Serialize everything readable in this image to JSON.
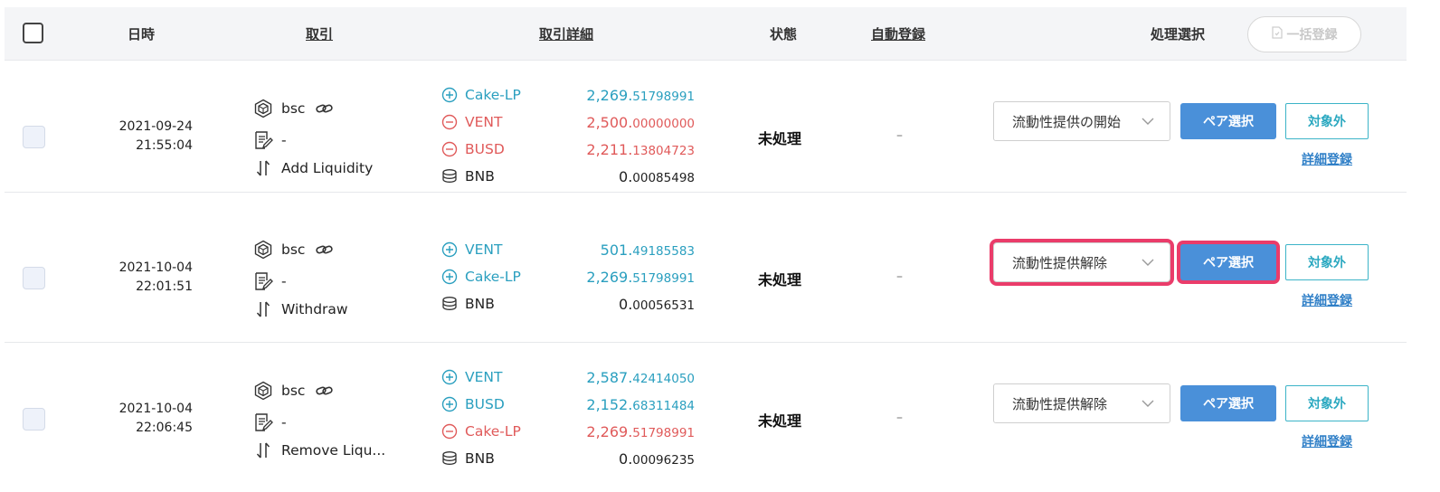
{
  "header": {
    "datetime": "日時",
    "transaction": "取引",
    "transaction_detail": "取引詳細",
    "status": "状態",
    "auto_register": "自動登録",
    "process_select": "処理選択",
    "bulk_register": "一括登録"
  },
  "rows": [
    {
      "date": "2021-09-24",
      "time": "21:55:04",
      "chain": "bsc",
      "memo": "-",
      "action": "Add Liquidity",
      "details": [
        {
          "dir": "in",
          "token": "Cake-LP",
          "int": "2,269.",
          "dec": "51798991"
        },
        {
          "dir": "out",
          "token": "VENT",
          "int": "2,500.",
          "dec": "00000000"
        },
        {
          "dir": "out",
          "token": "BUSD",
          "int": "2,211.",
          "dec": "13804723"
        },
        {
          "dir": "fee",
          "token": "BNB",
          "int": "0.",
          "dec": "00085498"
        }
      ],
      "status": "未処理",
      "auto": "–",
      "select_value": "流動性提供の開始",
      "pair_button": "ペア選択",
      "exclude_button": "対象外",
      "detail_link": "詳細登録"
    },
    {
      "date": "2021-10-04",
      "time": "22:01:51",
      "chain": "bsc",
      "memo": "-",
      "action": "Withdraw",
      "details": [
        {
          "dir": "in",
          "token": "VENT",
          "int": "501.",
          "dec": "49185583"
        },
        {
          "dir": "in",
          "token": "Cake-LP",
          "int": "2,269.",
          "dec": "51798991"
        },
        {
          "dir": "fee",
          "token": "BNB",
          "int": "0.",
          "dec": "00056531"
        }
      ],
      "status": "未処理",
      "auto": "–",
      "select_value": "流動性提供解除",
      "pair_button": "ペア選択",
      "exclude_button": "対象外",
      "detail_link": "詳細登録"
    },
    {
      "date": "2021-10-04",
      "time": "22:06:45",
      "chain": "bsc",
      "memo": "-",
      "action": "Remove Liqu...",
      "details": [
        {
          "dir": "in",
          "token": "VENT",
          "int": "2,587.",
          "dec": "42414050"
        },
        {
          "dir": "in",
          "token": "BUSD",
          "int": "2,152.",
          "dec": "68311484"
        },
        {
          "dir": "out",
          "token": "Cake-LP",
          "int": "2,269.",
          "dec": "51798991"
        },
        {
          "dir": "fee",
          "token": "BNB",
          "int": "0.",
          "dec": "00096235"
        }
      ],
      "status": "未処理",
      "auto": "–",
      "select_value": "流動性提供解除",
      "pair_button": "ペア選択",
      "exclude_button": "対象外",
      "detail_link": "詳細登録"
    }
  ],
  "colors": {
    "in": "#2a9fbf",
    "out": "#e05a5a",
    "primary_button": "#4a90d9",
    "highlight": "#ea3c6a"
  }
}
